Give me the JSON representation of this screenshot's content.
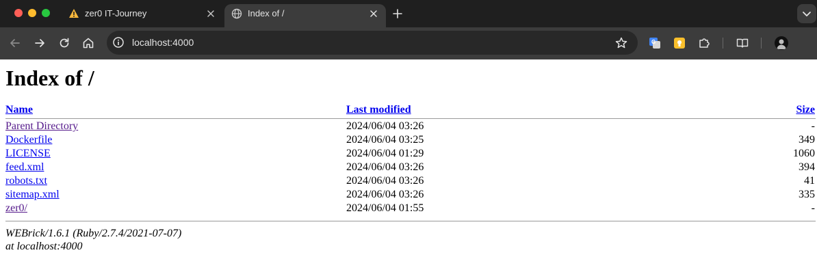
{
  "browser": {
    "tabs": [
      {
        "title": "zer0 IT-Journey",
        "active": false,
        "favicon": "warning-triangle-icon"
      },
      {
        "title": "Index of /",
        "active": true,
        "favicon": "globe-icon"
      }
    ],
    "address_bar": {
      "url": "localhost:4000"
    },
    "colors": {
      "chrome": "#1f1f1f",
      "toolbar": "#3c3c3c",
      "omnibox": "#282828"
    }
  },
  "page": {
    "heading": "Index of /",
    "columns": {
      "name": "Name",
      "last_modified": "Last modified",
      "size": "Size"
    },
    "rows": [
      {
        "name": "Parent Directory",
        "modified": "2024/06/04 03:26",
        "size": "-"
      },
      {
        "name": "Dockerfile",
        "modified": "2024/06/04 03:25",
        "size": "349"
      },
      {
        "name": "LICENSE",
        "modified": "2024/06/04 01:29",
        "size": "1060"
      },
      {
        "name": "feed.xml",
        "modified": "2024/06/04 03:26",
        "size": "394"
      },
      {
        "name": "robots.txt",
        "modified": "2024/06/04 03:26",
        "size": "41"
      },
      {
        "name": "sitemap.xml",
        "modified": "2024/06/04 03:26",
        "size": "335"
      },
      {
        "name": "zer0/",
        "modified": "2024/06/04 01:55",
        "size": "-"
      }
    ],
    "footer": {
      "server": "WEBrick/1.6.1 (Ruby/2.7.4/2021-07-07)",
      "host": "at localhost:4000"
    },
    "colors": {
      "link": "#0000ee",
      "visited_link": "#551a8b"
    }
  }
}
